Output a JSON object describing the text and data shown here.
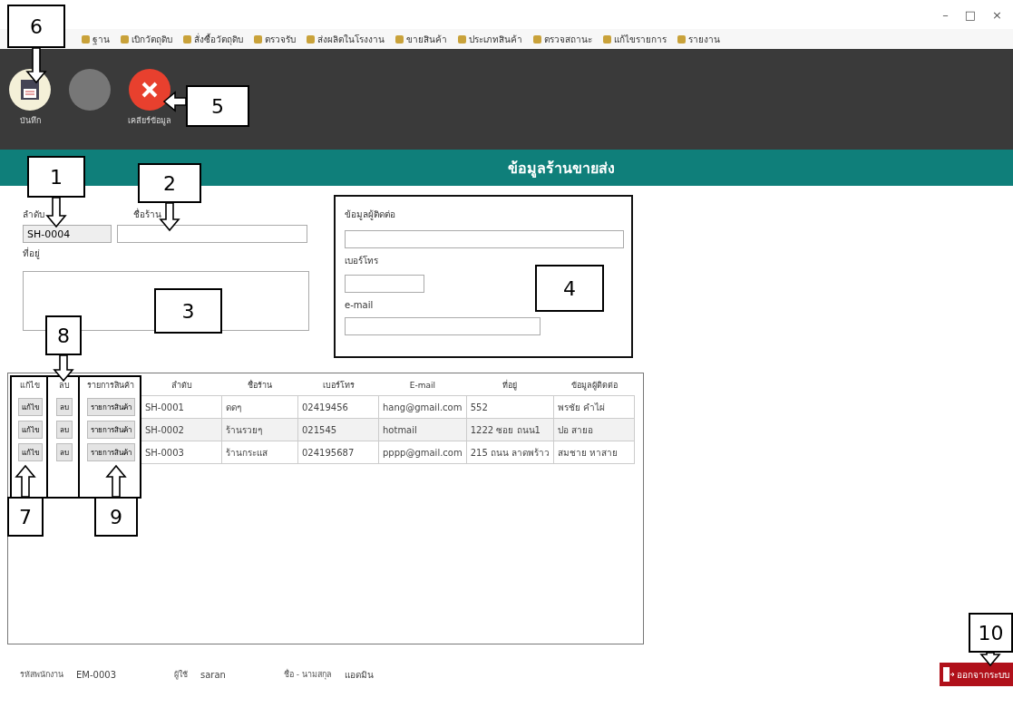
{
  "window": {
    "controls": [
      "–",
      "□",
      "×"
    ]
  },
  "menu": [
    {
      "label": "ฐาน"
    },
    {
      "label": "เบิกวัตถุดิบ"
    },
    {
      "label": "สั่งซื้อวัตถุดิบ"
    },
    {
      "label": "ตรวจรับ"
    },
    {
      "label": "ส่งผลิตในโรงงาน"
    },
    {
      "label": "ขายสินค้า"
    },
    {
      "label": "ประเภทสินค้า"
    },
    {
      "label": "ตรวจสถานะ"
    },
    {
      "label": "แก้ไขรายการ"
    },
    {
      "label": "รายงาน"
    }
  ],
  "toolbar": [
    {
      "kind": "save",
      "label": "บันทึก"
    },
    {
      "kind": "blank"
    },
    {
      "kind": "clear",
      "label": "เคลียร์ข้อมูล"
    }
  ],
  "header": {
    "title": "ข้อมูลร้านขายส่ง"
  },
  "form": {
    "id_label": "ลำดับ",
    "id_value": "SH-0004",
    "name_label": "ชื่อร้าน",
    "address_label": "ที่อยู่",
    "contact_label": "ข้อมูลผู้ติดต่อ",
    "phone_label": "เบอร์โทร",
    "email_label": "e-mail"
  },
  "table": {
    "columns": [
      "แก้ไข",
      "ลบ",
      "รายการสินค้า",
      "ลำดับ",
      "ชื่อร้าน",
      "เบอร์โทร",
      "E-mail",
      "ที่อยู่",
      "ข้อมูลผู้ติดต่อ"
    ],
    "rows": [
      {
        "cells": [
          "แก้ไข",
          "ลบ",
          "รายการสินค้า",
          "SH-0001",
          "ดดๆ",
          "02419456",
          "hang@gmail.com",
          "552",
          "พรชัย คำไผ่"
        ]
      },
      {
        "cells": [
          "แก้ไข",
          "ลบ",
          "รายการสินค้า",
          "SH-0002",
          "ร้านรวยๆ",
          "021545",
          "hotmail",
          "1222 ซอย ถนน1",
          "ปอ สายอ"
        ]
      },
      {
        "cells": [
          "แก้ไข",
          "ลบ",
          "รายการสินค้า",
          "SH-0003",
          "ร้านกระแส",
          "024195687",
          "pppp@gmail.com",
          "215 ถนน ลาดพร้าว",
          "สมชาย หาสาย"
        ]
      }
    ]
  },
  "footer": {
    "items": [
      {
        "label": "รหัสพนักงาน",
        "value": "EM-0003"
      },
      {
        "label": "ผู้ใช้",
        "value": "saran"
      },
      {
        "label": "ชื่อ - นามสกุล",
        "value": "แอดมิน"
      }
    ],
    "logout": "ออกจากระบบ"
  },
  "callouts": [
    {
      "number": "1"
    },
    {
      "number": "2"
    },
    {
      "number": "3"
    },
    {
      "number": "4"
    },
    {
      "number": "5"
    },
    {
      "number": "6"
    },
    {
      "number": "7"
    },
    {
      "number": "8"
    },
    {
      "number": "9"
    },
    {
      "number": "10"
    }
  ]
}
